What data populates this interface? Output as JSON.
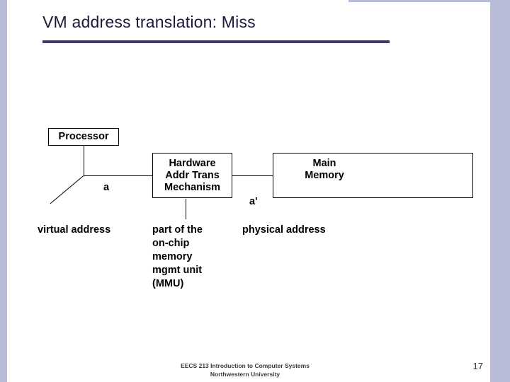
{
  "slide": {
    "title": "VM address translation: Miss",
    "page_number": "17",
    "footer_line1": "EECS 213 Introduction to Computer Systems",
    "footer_line2": "Northwestern University"
  },
  "colors": {
    "accent_bar": "#b9bcd6",
    "title_text": "#1a1a3d",
    "title_rule": "#3a3a6b",
    "box_border": "#000000"
  },
  "diagram": {
    "boxes": {
      "processor": "Processor",
      "hardware_addr_trans": "Hardware\nAddr Trans\nMechanism",
      "hardware_addr_trans_lines": [
        "Hardware",
        "Addr Trans",
        "Mechanism"
      ],
      "main_memory": "Main\nMemory",
      "main_memory_lines": [
        "Main",
        "Memory"
      ]
    },
    "labels": {
      "a": "a",
      "a_prime": "a'",
      "virtual_address": "virtual address",
      "part_of_mmu": "part of the\non-chip\nmemory\nmgmt unit\n(MMU)",
      "physical_address": "physical address"
    }
  }
}
